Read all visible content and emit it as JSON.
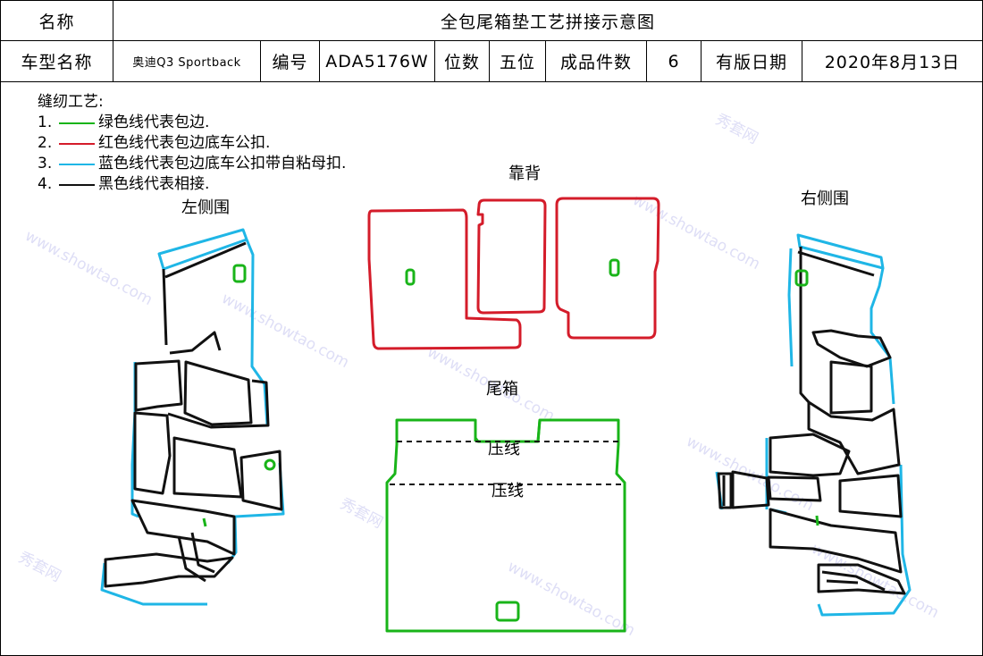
{
  "header": {
    "name_label": "名称",
    "doc_title": "全包尾箱垫工艺拼接示意图",
    "model_label": "车型名称",
    "model_value": "奥迪Q3 Sportback",
    "code_label": "编号",
    "code_value": "ADA5176W",
    "position_label": "位数",
    "position_value": "五位",
    "pieces_label": "成品件数",
    "pieces_value": "6",
    "date_label": "有版日期",
    "date_value": "2020年8月13日"
  },
  "legend": {
    "title": "缝纫工艺:",
    "items": [
      {
        "num": "1.",
        "color": "#19b419",
        "text": "绿色线代表包边."
      },
      {
        "num": "2.",
        "color": "#d41c2a",
        "text": "红色线代表包边底车公扣."
      },
      {
        "num": "3.",
        "color": "#1fb6e6",
        "text": "蓝色线代表包边底车公扣带自粘母扣."
      },
      {
        "num": "4.",
        "color": "#111111",
        "text": "黑色线代表相接."
      }
    ]
  },
  "parts": {
    "left_side": "左侧围",
    "backrest": "靠背",
    "right_side": "右侧围",
    "trunk": "尾箱",
    "press_line_1": "压线",
    "press_line_2": "压线"
  },
  "watermark": {
    "text_cn": "秀套网",
    "text_en": "www.showtao.com"
  },
  "colors": {
    "green": "#19b419",
    "red": "#d41c2a",
    "blue": "#1fb6e6",
    "black": "#111111"
  }
}
